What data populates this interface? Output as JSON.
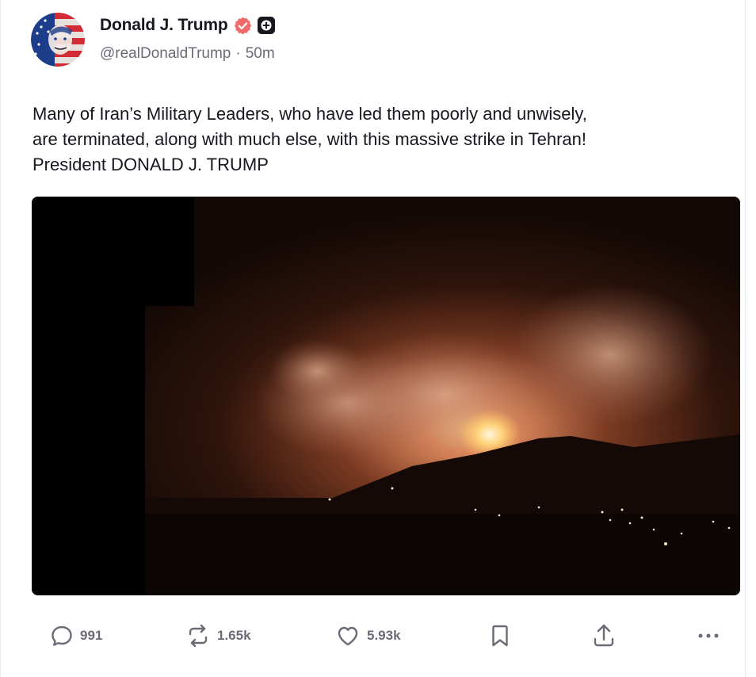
{
  "author": {
    "display_name": "Donald J. Trump",
    "handle": "@realDonaldTrump",
    "separator": "·",
    "time_ago": "50m"
  },
  "post": {
    "text": "Many of Iran’s Military Leaders, who have led them poorly and unwisely,\nare terminated, along with much else, with this massive strike in Tehran!\nPresident DONALD J. TRUMP"
  },
  "actions": {
    "replies": "991",
    "reposts": "1.65k",
    "likes": "5.93k"
  },
  "icons": {
    "verified": "verified-badge-icon",
    "plus": "plus-badge-icon",
    "reply": "comment-bubble-icon",
    "repost": "repost-arrows-icon",
    "like": "heart-icon",
    "bookmark": "bookmark-icon",
    "share": "share-upload-icon",
    "more": "more-dots-icon"
  },
  "colors": {
    "verified": "#f06a6a",
    "text": "#17171f",
    "muted": "#6b6b78"
  }
}
